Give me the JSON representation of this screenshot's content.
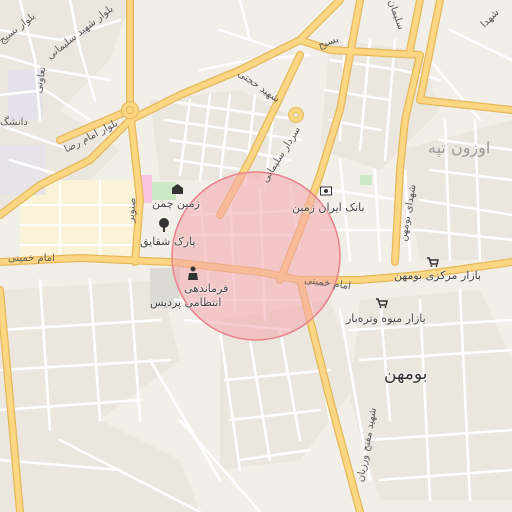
{
  "map": {
    "colors": {
      "background": "#f2efe9",
      "major_road": "#fcd682",
      "major_road_casing": "#e6b85c",
      "minor_road": "#ffffff",
      "block": "#ede9e1",
      "park": "#cde8c4",
      "pink_area": "#f7c5df",
      "highlight_fill": "#f4a6ad",
      "highlight_stroke": "#e8818b"
    },
    "highlight": {
      "shape": "circle"
    },
    "labels": {
      "blvd_shahid_soleimani": "بلوار شهید سلیمانی",
      "blvd_basij_top": "بلوار بسیج",
      "tavoni": "تعاونی",
      "daneshgah": "دانشگ",
      "blvd_imam_reza": "بلوار امام رضا",
      "shahid_hojjati": "شهید حجتی",
      "basij": "بسیج",
      "soleimani_top": "سلیمان",
      "shohada_top": "شهدا",
      "ozoun_tappeh": "اوزون تپه",
      "sardar_soleimani": "سردار سلیمانی",
      "bank_iran_zamin": "بانک ایران زمین",
      "zamin_chaman": "زمین چمن",
      "sanobar": "صنوبر",
      "park_shaghayegh": "پارک شقایق",
      "shohada_road": "شهدای بومهن",
      "imam_khomeini_left": "امام خمینی",
      "imam_khomeini_center": "امام خمینی",
      "bazar_markazi_boumehen": "بازار مرکزی بومهن",
      "farmandehi_line1": "فرماندهی",
      "farmandehi_line2": "انتظامی پردیس",
      "bazar_miveh": "بازار میوه وتره‌بار",
      "boumehen": "بومهن",
      "shahid_mofatteh": "شهید مفتح ورزیان"
    },
    "icons": {
      "bank": "bank-icon",
      "building": "building-icon",
      "park": "tree-icon",
      "police": "police-icon",
      "market1": "shopping-cart-icon",
      "market2": "shopping-cart-icon"
    }
  }
}
